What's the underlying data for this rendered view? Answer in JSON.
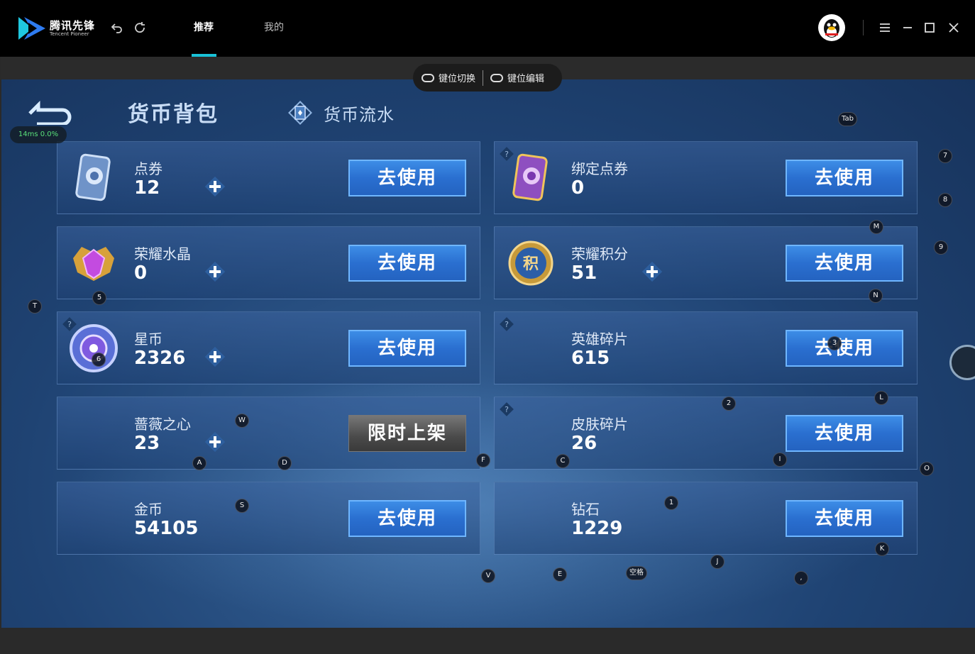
{
  "app": {
    "logo_cn": "腾讯先锋",
    "logo_en": "Tencent Pioneer",
    "tabs": [
      {
        "label": "推荐",
        "active": true
      },
      {
        "label": "我的",
        "active": false
      }
    ],
    "accent": "#19c1d6"
  },
  "keybar": {
    "switch_label": "键位切换",
    "edit_label": "键位编辑"
  },
  "latency": "14ms  0.0%",
  "header": {
    "title": "货币背包",
    "subtitle": "货币流水"
  },
  "cards": [
    {
      "label": "点券",
      "value": "12",
      "button": "去使用",
      "plus": true,
      "help": false
    },
    {
      "label": "绑定点券",
      "value": "0",
      "button": "去使用",
      "plus": false,
      "help": true
    },
    {
      "label": "荣耀水晶",
      "value": "0",
      "button": "去使用",
      "plus": true,
      "help": false
    },
    {
      "label": "荣耀积分",
      "value": "51",
      "button": "去使用",
      "plus": true,
      "help": false
    },
    {
      "label": "星币",
      "value": "2326",
      "button": "去使用",
      "plus": true,
      "help": true
    },
    {
      "label": "英雄碎片",
      "value": "615",
      "button": "去使用",
      "plus": false,
      "help": true
    },
    {
      "label": "蔷薇之心",
      "value": "23",
      "button": "限时上架",
      "plus": true,
      "help": false
    },
    {
      "label": "皮肤碎片",
      "value": "26",
      "button": "去使用",
      "plus": false,
      "help": true
    },
    {
      "label": "金币",
      "value": "54105",
      "button": "去使用",
      "plus": false,
      "help": false
    },
    {
      "label": "钻石",
      "value": "1229",
      "button": "去使用",
      "plus": false,
      "help": false
    }
  ],
  "keys": {
    "tab": "Tab",
    "k7": "7",
    "k8": "8",
    "kM": "M",
    "k9": "9",
    "kN": "N",
    "kT": "T",
    "k5": "5",
    "k6": "6",
    "k3": "3",
    "k2": "2",
    "kL": "L",
    "kW": "W",
    "kA": "A",
    "kD": "D",
    "kF": "F",
    "kC": "C",
    "kI": "I",
    "kO": "O",
    "kS": "S",
    "k1": "1",
    "kK": "K",
    "kJ": "J",
    "kV": "V",
    "kE": "E",
    "space": "空格",
    "comma": ","
  }
}
